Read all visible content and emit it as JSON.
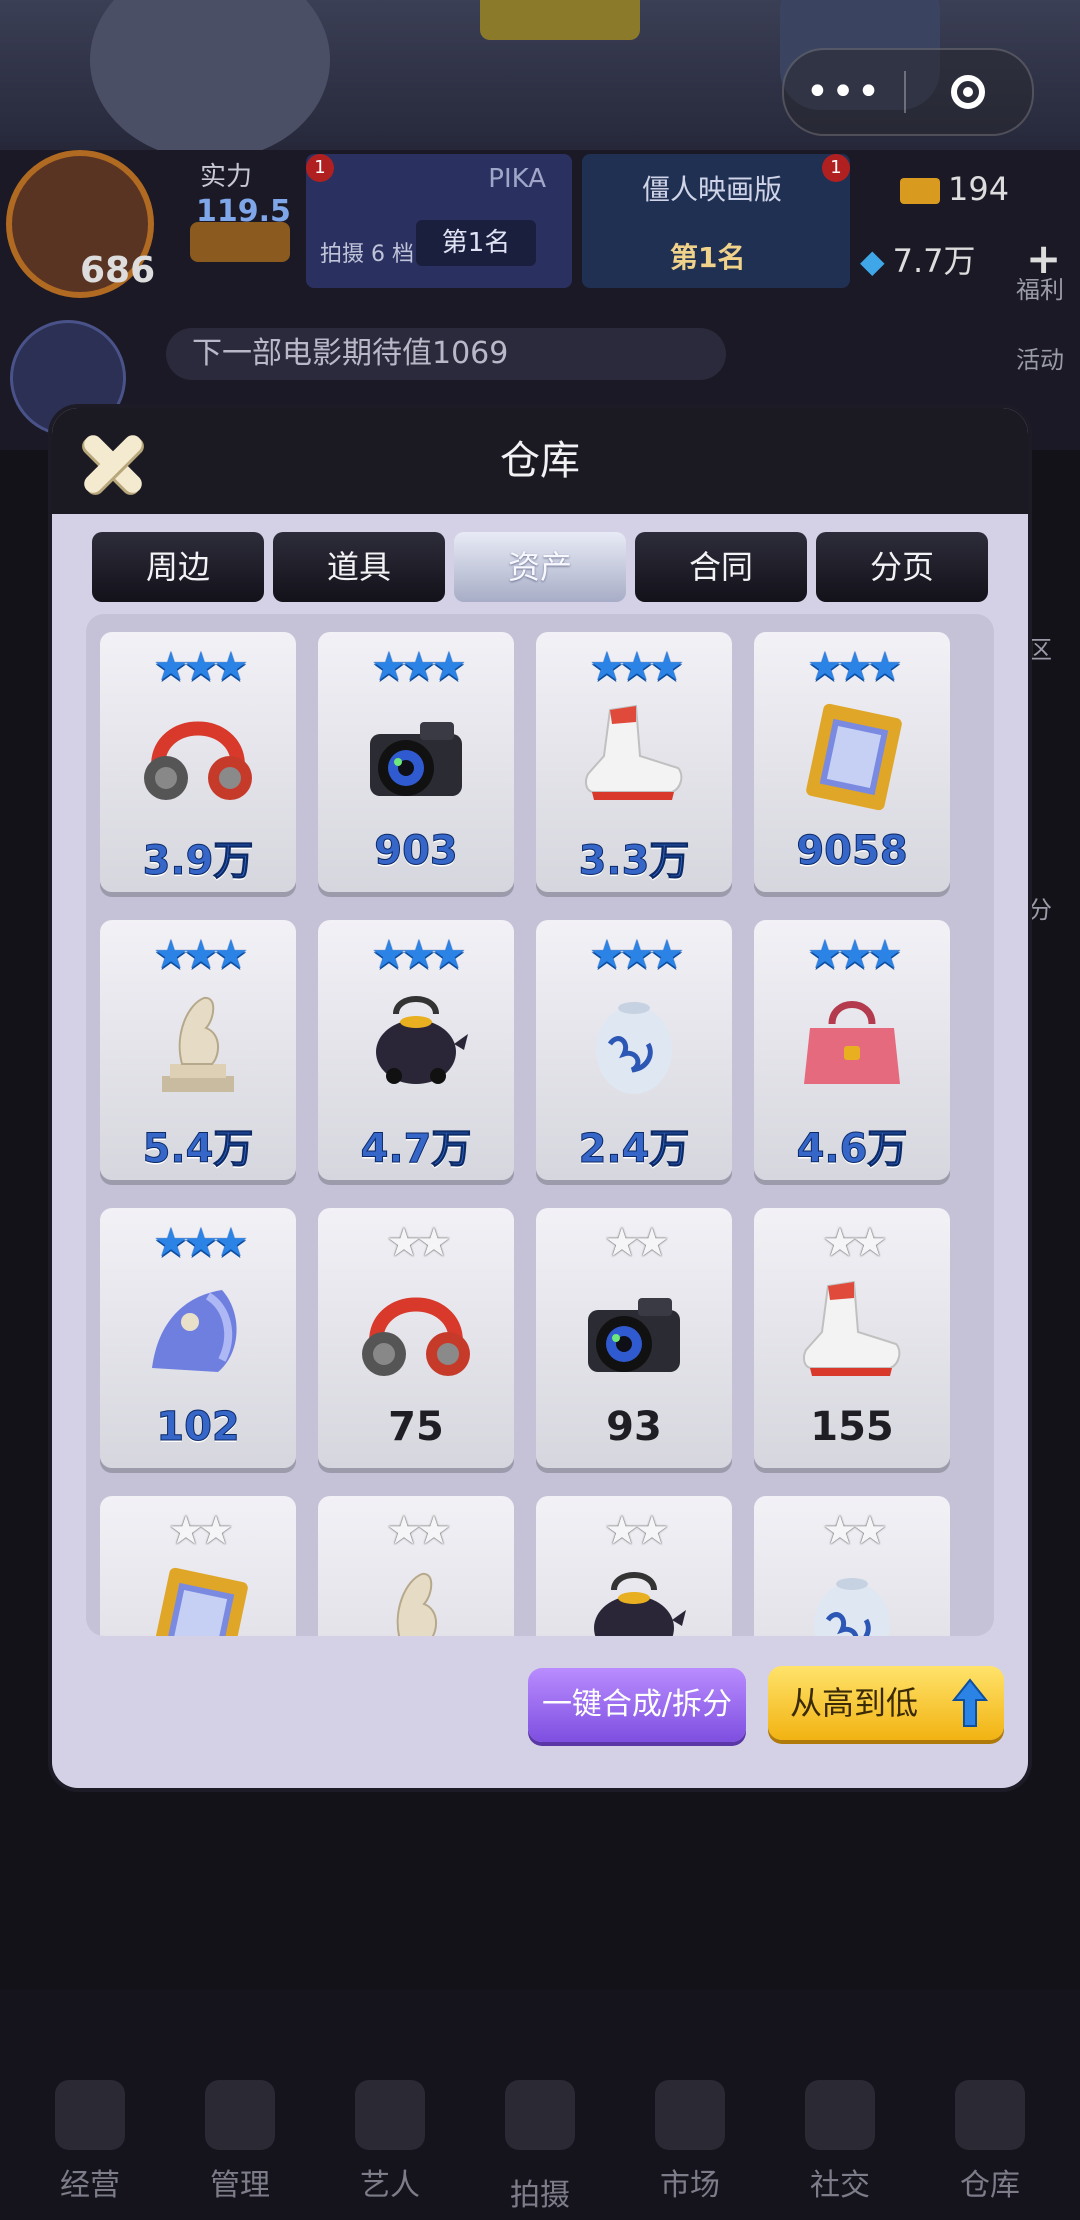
{
  "capsule": {
    "more_glyph": "•••"
  },
  "hud": {
    "level": "686",
    "power_label": "实力",
    "power_value": "119.5",
    "rank_left": {
      "name": "PIKA",
      "small": "拍摄 6 档",
      "place": "第1名",
      "badge": "1"
    },
    "rank_right": {
      "name": "僵人映画版",
      "place": "第1名",
      "badge": "1"
    },
    "coins": "194",
    "gems": "7.7万",
    "plus": "+",
    "movie_label": "下一部电影期待值1069"
  },
  "side_right": [
    "福利",
    "活动",
    "区",
    "分"
  ],
  "modal": {
    "title": "仓库",
    "tabs": [
      {
        "label": "周边",
        "active": false
      },
      {
        "label": "道具",
        "active": false
      },
      {
        "label": "资产",
        "active": true
      },
      {
        "label": "合同",
        "active": false
      },
      {
        "label": "分页",
        "active": false
      }
    ],
    "items": [
      {
        "icon": "headphones-icon",
        "stars": 3,
        "tier": "blue",
        "value": "3.9万"
      },
      {
        "icon": "camera-icon",
        "stars": 3,
        "tier": "blue",
        "value": "903"
      },
      {
        "icon": "sneaker-icon",
        "stars": 3,
        "tier": "blue",
        "value": "3.3万"
      },
      {
        "icon": "picture-frame-icon",
        "stars": 3,
        "tier": "blue",
        "value": "9058"
      },
      {
        "icon": "stone-sculpture-icon",
        "stars": 3,
        "tier": "blue",
        "value": "5.4万"
      },
      {
        "icon": "teapot-icon",
        "stars": 3,
        "tier": "blue",
        "value": "4.7万"
      },
      {
        "icon": "porcelain-vase-icon",
        "stars": 3,
        "tier": "blue",
        "value": "2.4万"
      },
      {
        "icon": "handbag-icon",
        "stars": 3,
        "tier": "blue",
        "value": "4.6万"
      },
      {
        "icon": "seashell-icon",
        "stars": 3,
        "tier": "blue",
        "value": "102"
      },
      {
        "icon": "headphones-icon",
        "stars": 2,
        "tier": "white",
        "value": "75"
      },
      {
        "icon": "camera-icon",
        "stars": 2,
        "tier": "white",
        "value": "93"
      },
      {
        "icon": "sneaker-icon",
        "stars": 2,
        "tier": "white",
        "value": "155"
      },
      {
        "icon": "picture-frame-icon",
        "stars": 2,
        "tier": "white",
        "value": ""
      },
      {
        "icon": "stone-sculpture-icon",
        "stars": 2,
        "tier": "white",
        "value": ""
      },
      {
        "icon": "teapot-icon",
        "stars": 2,
        "tier": "white",
        "value": ""
      },
      {
        "icon": "porcelain-vase-icon",
        "stars": 2,
        "tier": "white",
        "value": ""
      }
    ],
    "merge_button": "一键合成/拆分",
    "sort_button": "从高到低"
  },
  "bottom_nav": [
    "经营",
    "管理",
    "艺人",
    "拍摄",
    "市场",
    "社交",
    "仓库"
  ],
  "colors": {
    "accent_blue": "#2c83e6",
    "merge_purple": "#8b5cf0",
    "sort_yellow": "#f7c72a"
  }
}
